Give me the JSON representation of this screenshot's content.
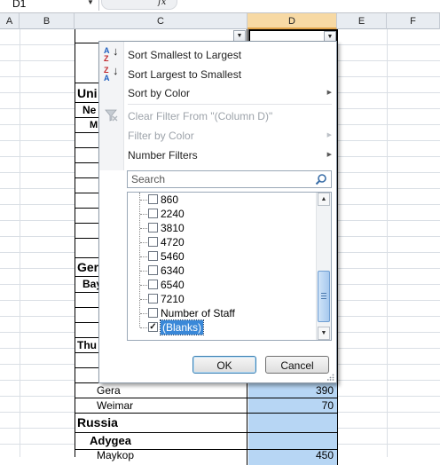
{
  "name_box": {
    "value": "D1"
  },
  "formula_bar": {
    "fx_label": "fx"
  },
  "columns": [
    {
      "label": "A"
    },
    {
      "label": "B"
    },
    {
      "label": "C"
    },
    {
      "label": "D",
      "selected": true
    },
    {
      "label": "E"
    },
    {
      "label": "F"
    }
  ],
  "sheet": {
    "highlight_color": "#b7d6f4",
    "rows_behind": [
      {
        "c": "Uni",
        "bold": true,
        "big": true
      },
      {
        "c": "Ne",
        "bold": true
      },
      {
        "c": "M",
        "bold": true
      },
      {
        "c": "Ger",
        "bold": true,
        "big": true
      },
      {
        "c": "Bay",
        "bold": true
      },
      {
        "c": "Thu",
        "bold": true
      }
    ],
    "visible_rows": [
      {
        "c": "Gera",
        "d": "390"
      },
      {
        "c": "Weimar",
        "d": "70"
      },
      {
        "c": "Russia",
        "d": ""
      },
      {
        "c": "Adygea",
        "d": ""
      },
      {
        "c": "Maykop",
        "d": "450"
      }
    ]
  },
  "filter_menu": {
    "items": [
      {
        "label": "Sort Smallest to Largest",
        "disabled": false,
        "arrow": false
      },
      {
        "label": "Sort Largest to Smallest",
        "disabled": false,
        "arrow": false
      },
      {
        "label": "Sort by Color",
        "disabled": false,
        "arrow": true
      },
      {
        "label": "Clear Filter From \"(Column D)\"",
        "disabled": true,
        "arrow": false
      },
      {
        "label": "Filter by Color",
        "disabled": true,
        "arrow": true
      },
      {
        "label": "Number Filters",
        "disabled": false,
        "arrow": true
      }
    ],
    "search_placeholder": "Search",
    "values": [
      {
        "label": "860",
        "checked": false
      },
      {
        "label": "2240",
        "checked": false
      },
      {
        "label": "3810",
        "checked": false
      },
      {
        "label": "4720",
        "checked": false
      },
      {
        "label": "5460",
        "checked": false
      },
      {
        "label": "6340",
        "checked": false
      },
      {
        "label": "6540",
        "checked": false
      },
      {
        "label": "7210",
        "checked": false
      },
      {
        "label": "Number of Staff",
        "checked": false
      },
      {
        "label": "(Blanks)",
        "checked": true,
        "selected": true
      }
    ],
    "ok_label": "OK",
    "cancel_label": "Cancel"
  }
}
